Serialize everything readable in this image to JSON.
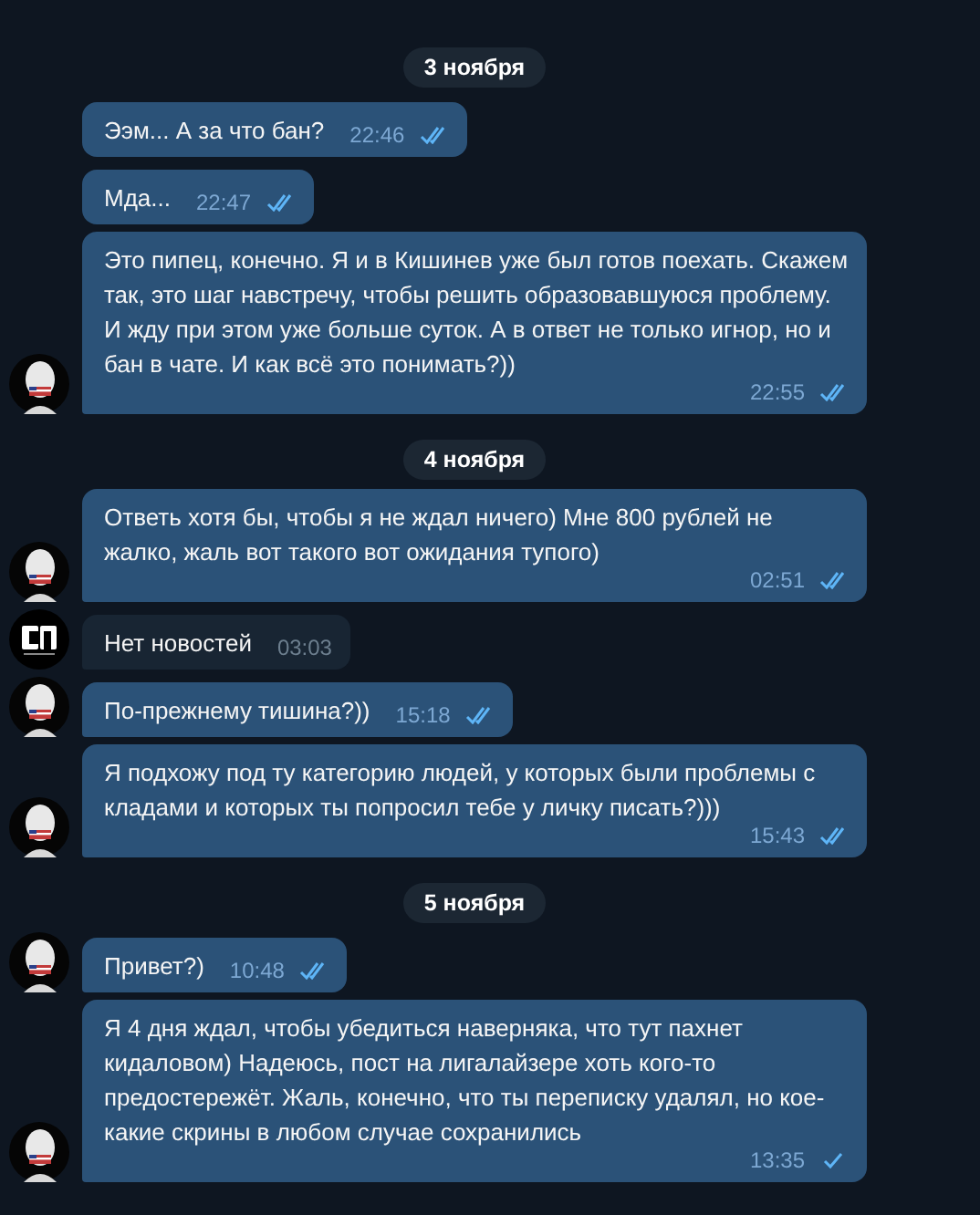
{
  "days": [
    {
      "date": "3 ноября",
      "messages": [
        {
          "kind": "own",
          "text": "Ээм... А за что бан?",
          "time": "22:46",
          "read": true,
          "avatar": false
        },
        {
          "kind": "own",
          "text": "Мда...",
          "time": "22:47",
          "read": true,
          "avatar": false
        },
        {
          "kind": "own",
          "text": "Это пипец, конечно. Я и в Кишинев уже был готов поехать. Скажем так, это шаг навстречу, чтобы решить образовавшуюся проблему. И жду при этом уже больше суток. А в ответ не только игнор, но и бан в чате. И как всё это понимать?))",
          "time": "22:55",
          "read": true,
          "avatar": true
        }
      ]
    },
    {
      "date": "4 ноября",
      "messages": [
        {
          "kind": "own",
          "text": "Ответь хотя бы, чтобы я не ждал ничего) Мне 800 рублей не жалко, жаль вот такого вот ожидания тупого)",
          "time": "02:51",
          "read": true,
          "avatar": true
        },
        {
          "kind": "other",
          "text": "Нет новостей",
          "time": "03:03",
          "avatar": true
        },
        {
          "kind": "own",
          "text": "По-прежнему тишина?))",
          "time": "15:18",
          "read": true,
          "avatar": true
        },
        {
          "kind": "own",
          "text": "Я подхожу под ту категорию людей, у которых были проблемы с кладами и которых ты попросил тебе у личку писать?)))",
          "time": "15:43",
          "read": true,
          "avatar": true
        }
      ]
    },
    {
      "date": "5 ноября",
      "messages": [
        {
          "kind": "own",
          "text": "Привет?)",
          "time": "10:48",
          "read": true,
          "avatar": true
        },
        {
          "kind": "own",
          "text": "Я 4 дня ждал, чтобы убедиться наверняка, что тут пахнет кидаловом) Надеюсь, пост на лигалайзере хоть кого-то предостережёт. Жаль, конечно, что ты переписку удалял, но кое-какие скрины в любом случае сохранились",
          "time": "13:35",
          "read": false,
          "avatar": true
        }
      ]
    }
  ]
}
